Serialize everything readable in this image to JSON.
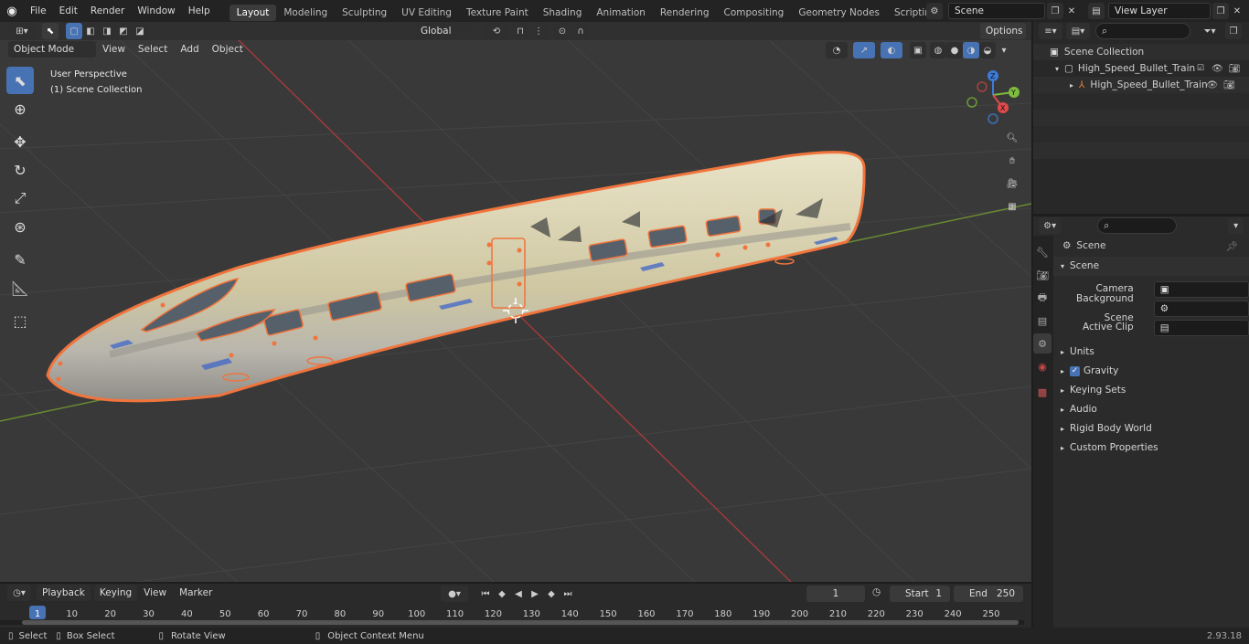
{
  "menu": [
    "File",
    "Edit",
    "Render",
    "Window",
    "Help"
  ],
  "workspaces": [
    "Layout",
    "Modeling",
    "Sculpting",
    "UV Editing",
    "Texture Paint",
    "Shading",
    "Animation",
    "Rendering",
    "Compositing",
    "Geometry Nodes",
    "Scripting"
  ],
  "active_workspace": "Layout",
  "scene_field": "Scene",
  "view_layer_field": "View Layer",
  "viewport_header": {
    "mode": "Object Mode",
    "menus": [
      "View",
      "Select",
      "Add",
      "Object"
    ],
    "orientation": "Global",
    "options": "Options"
  },
  "overlay_text": {
    "perspective": "User Perspective",
    "collection": "(1) Scene Collection"
  },
  "gizmo_axes": {
    "x": "X",
    "y": "Y",
    "z": "Z"
  },
  "outliner": {
    "root": "Scene Collection",
    "items": [
      {
        "label": "High_Speed_Bullet_Train_Loc"
      },
      {
        "label": "High_Speed_Bullet_Train"
      }
    ]
  },
  "properties": {
    "header": "Scene",
    "section": "Scene",
    "fields": [
      {
        "label": "Camera",
        "value": ""
      },
      {
        "label": "Background Scene",
        "value": ""
      },
      {
        "label": "Active Clip",
        "value": ""
      }
    ],
    "collapsed": [
      "Units",
      "Gravity",
      "Keying Sets",
      "Audio",
      "Rigid Body World",
      "Custom Properties"
    ],
    "gravity_checked": true
  },
  "timeline": {
    "menus": [
      "Playback",
      "Keying",
      "View",
      "Marker"
    ],
    "current_frame": "1",
    "start_label": "Start",
    "start": "1",
    "end_label": "End",
    "end": "250",
    "ticks": [
      "1",
      "10",
      "20",
      "30",
      "40",
      "50",
      "60",
      "70",
      "80",
      "90",
      "100",
      "110",
      "120",
      "130",
      "140",
      "150",
      "160",
      "170",
      "180",
      "190",
      "200",
      "210",
      "220",
      "230",
      "240",
      "250"
    ]
  },
  "status": {
    "select": "Select",
    "box_select": "Box Select",
    "rotate": "Rotate View",
    "context": "Object Context Menu",
    "version": "2.93.18"
  },
  "colors": {
    "accent": "#4772b3",
    "selection": "#f0743c",
    "x_axis": "#e04a4a",
    "y_axis": "#7fbb3c"
  }
}
